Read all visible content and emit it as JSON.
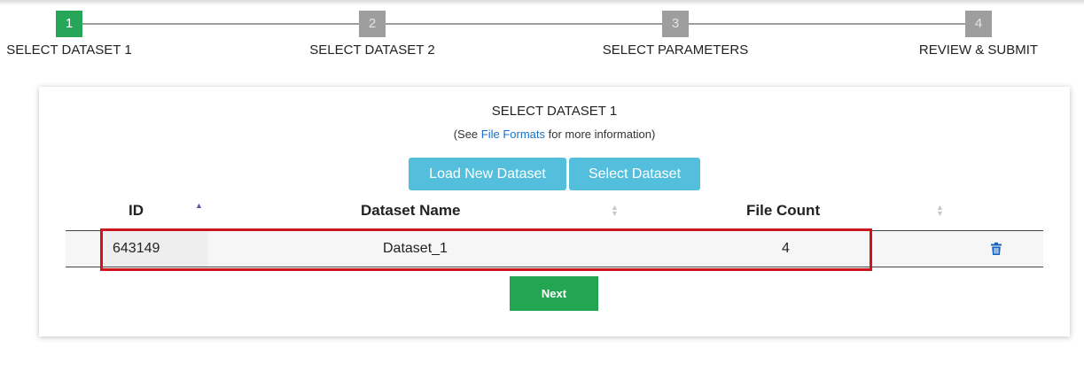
{
  "steps": [
    {
      "number": "1",
      "label": "SELECT DATASET 1",
      "active": true
    },
    {
      "number": "2",
      "label": "SELECT DATASET 2",
      "active": false
    },
    {
      "number": "3",
      "label": "SELECT PARAMETERS",
      "active": false
    },
    {
      "number": "4",
      "label": "REVIEW & SUBMIT",
      "active": false
    }
  ],
  "card": {
    "title": "SELECT DATASET 1",
    "subtitle_prefix": "(See ",
    "subtitle_link": "File Formats",
    "subtitle_suffix": " for more information)",
    "load_button": "Load New Dataset",
    "select_button": "Select Dataset"
  },
  "table": {
    "columns": [
      "ID",
      "Dataset Name",
      "File Count"
    ],
    "rows": [
      {
        "id": "643149",
        "name": "Dataset_1",
        "file_count": "4"
      }
    ]
  },
  "next_label": "Next",
  "colors": {
    "step_active": "#27a65a",
    "step_inactive": "#9e9e9e",
    "info_button": "#54bfdc",
    "next_button": "#22a652",
    "highlight": "#d0141c",
    "link": "#1a73c8"
  },
  "icons": {
    "delete": "trash-icon",
    "sort_asc": "sort-asc-icon",
    "sort": "sort-icon"
  }
}
